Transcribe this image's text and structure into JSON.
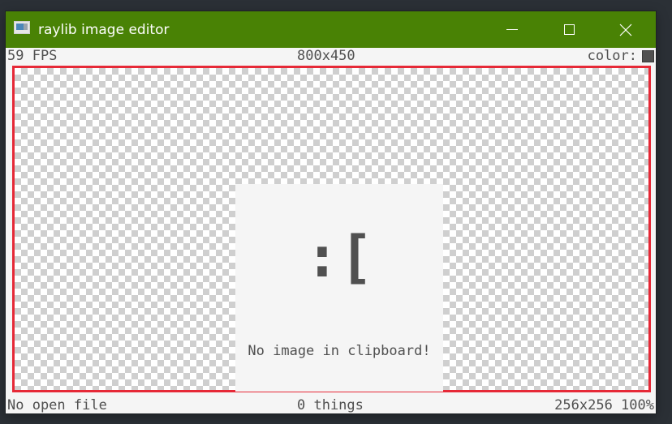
{
  "window": {
    "title": "raylib image editor",
    "titlebar_color": "#498205",
    "icons": {
      "app": "app-image-icon",
      "minimize": "minimize-icon",
      "maximize": "maximize-icon",
      "close": "close-icon"
    },
    "close_glyph": "✕"
  },
  "status_top": {
    "fps": "59 FPS",
    "dimensions": "800x450",
    "color_label": "color:",
    "color_value": "#505050"
  },
  "canvas": {
    "border_color": "#e62937",
    "sad_face": ":[",
    "message": "No image in clipboard!"
  },
  "status_bottom": {
    "file": "No open file",
    "things": "0 things",
    "zoom_info": "256x256 100%"
  }
}
